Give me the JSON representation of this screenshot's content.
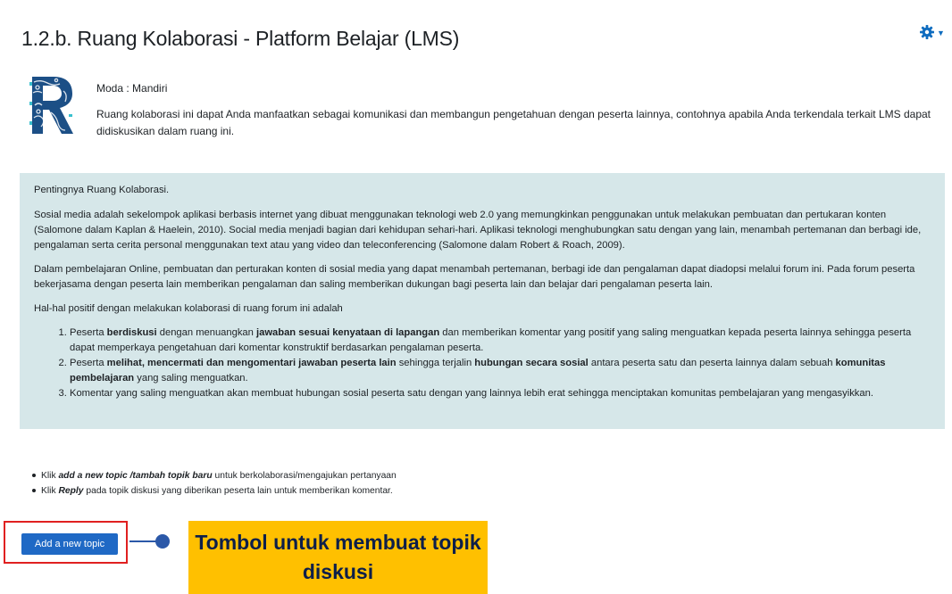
{
  "page": {
    "title": "1.2.b. Ruang Kolaborasi - Platform Belajar (LMS)"
  },
  "header": {
    "settings_icon": "gear-icon",
    "menu_caret_icon": "caret-down-icon"
  },
  "intro": {
    "moda": "Moda : Mandiri",
    "description": "Ruang kolaborasi ini dapat Anda manfaatkan sebagai komunikasi dan membangun pengetahuan dengan peserta lainnya, contohnya  apabila Anda terkendala terkait LMS dapat didiskusikan dalam ruang ini."
  },
  "panel": {
    "heading": "Pentingnya Ruang Kolaborasi.",
    "paragraph1": "Sosial media adalah sekelompok aplikasi berbasis internet yang dibuat menggunakan teknologi web 2.0 yang memungkinkan penggunakan untuk melakukan pembuatan dan pertukaran konten (Salomone dalam Kaplan & Haelein, 2010). Social media menjadi bagian dari kehidupan sehari-hari. Aplikasi teknologi menghubungkan satu dengan yang lain, menambah pertemanan dan berbagi ide, pengalaman serta cerita personal menggunakan text atau yang video dan teleconferencing (Salomone dalam Robert & Roach, 2009).",
    "paragraph2": "Dalam  pembelajaran Online, pembuatan dan perturakan konten di sosial media yang dapat menambah pertemanan, berbagi ide dan pengalaman dapat diadopsi melalui forum ini. Pada forum peserta  bekerjasama dengan peserta lain memberikan pengalaman dan saling  memberikan dukungan bagi peserta lain dan belajar dari pengalaman peserta lain.",
    "list_intro": "Hal-hal positif dengan melakukan kolaborasi di ruang forum ini adalah",
    "item1": {
      "a": "Peserta ",
      "b": "berdiskusi",
      "c": " dengan menuangkan ",
      "d": "jawaban sesuai kenyataan di lapangan",
      "e": " dan memberikan komentar yang positif yang saling menguatkan kepada peserta lainnya sehingga peserta dapat memperkaya pengetahuan dari komentar konstruktif berdasarkan pengalaman peserta."
    },
    "item2": {
      "a": "Peserta ",
      "b": "melihat, mencermati dan mengomentari jawaban peserta lain",
      "c": " sehingga terjalin ",
      "d": "hubungan secara sosial",
      "e": " antara peserta satu dan peserta lainnya dalam sebuah ",
      "f": "komunitas pembelajaran",
      "g": " yang saling menguatkan."
    },
    "item3": "Komentar yang saling menguatkan akan membuat hubungan sosial peserta satu dengan yang lainnya lebih erat sehingga menciptakan komunitas pembelajaran yang mengasyikkan."
  },
  "instructions": {
    "item1": {
      "a": "Klik ",
      "b": "add a new topic /tambah topik baru",
      "c": " untuk berkolaborasi/mengajukan pertanyaan"
    },
    "item2": {
      "a": "Klik ",
      "b": "Reply",
      "c": " pada topik diskusi yang diberikan peserta lain untuk memberikan komentar."
    }
  },
  "actions": {
    "add_topic_label": "Add a new topic"
  },
  "annotation": {
    "callout_text": "Tombol untuk membuat topik diskusi"
  },
  "colors": {
    "panel_bg": "#d6e7e9",
    "button_blue": "#1f69c5",
    "highlight_red": "#e02020",
    "callout_yellow": "#ffc000",
    "callout_text": "#0d1f4a"
  }
}
